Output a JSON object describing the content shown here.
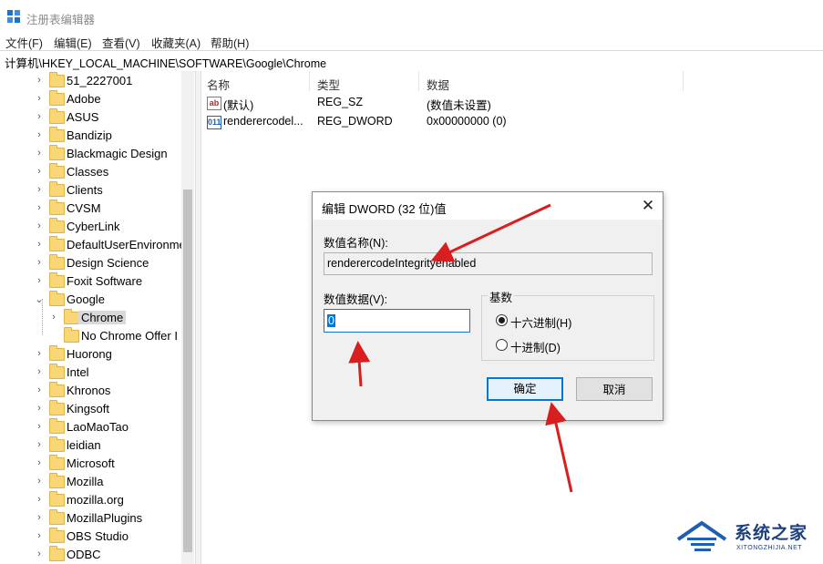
{
  "window": {
    "title": "注册表编辑器"
  },
  "menu": [
    "文件(F)",
    "编辑(E)",
    "查看(V)",
    "收藏夹(A)",
    "帮助(H)"
  ],
  "address": "计算机\\HKEY_LOCAL_MACHINE\\SOFTWARE\\Google\\Chrome",
  "tree": {
    "items": [
      {
        "label": "51_2227001",
        "chev": "›"
      },
      {
        "label": "Adobe",
        "chev": "›"
      },
      {
        "label": "ASUS",
        "chev": "›"
      },
      {
        "label": "Bandizip",
        "chev": "›"
      },
      {
        "label": "Blackmagic Design",
        "chev": "›"
      },
      {
        "label": "Classes",
        "chev": "›"
      },
      {
        "label": "Clients",
        "chev": "›"
      },
      {
        "label": "CVSM",
        "chev": "›"
      },
      {
        "label": "CyberLink",
        "chev": "›"
      },
      {
        "label": "DefaultUserEnvironme",
        "chev": "›"
      },
      {
        "label": "Design Science",
        "chev": "›"
      },
      {
        "label": "Foxit Software",
        "chev": "›"
      },
      {
        "label": "Google",
        "chev": "⌄"
      },
      {
        "label": "Chrome",
        "chev": "›"
      },
      {
        "label": "No Chrome Offer I",
        "chev": ""
      },
      {
        "label": "Huorong",
        "chev": "›"
      },
      {
        "label": "Intel",
        "chev": "›"
      },
      {
        "label": "Khronos",
        "chev": "›"
      },
      {
        "label": "Kingsoft",
        "chev": "›"
      },
      {
        "label": "LaoMaoTao",
        "chev": "›"
      },
      {
        "label": "leidian",
        "chev": "›"
      },
      {
        "label": "Microsoft",
        "chev": "›"
      },
      {
        "label": "Mozilla",
        "chev": "›"
      },
      {
        "label": "mozilla.org",
        "chev": "›"
      },
      {
        "label": "MozillaPlugins",
        "chev": "›"
      },
      {
        "label": "OBS Studio",
        "chev": "›"
      },
      {
        "label": "ODBC",
        "chev": "›"
      }
    ]
  },
  "list": {
    "headers": [
      "名称",
      "类型",
      "数据"
    ],
    "rows": [
      {
        "icon": "ab",
        "name": "(默认)",
        "type": "REG_SZ",
        "data": "(数值未设置)"
      },
      {
        "icon": "011",
        "name": "renderercodel...",
        "type": "REG_DWORD",
        "data": "0x00000000 (0)"
      }
    ]
  },
  "dialog": {
    "title": "编辑 DWORD (32 位)值",
    "close": "✕",
    "name_label": "数值名称(N):",
    "name_value": "renderercodeIntegrityenabled",
    "data_label": "数值数据(V):",
    "data_value": "0",
    "base_label": "基数",
    "radio_hex": "十六进制(H)",
    "radio_dec": "十进制(D)",
    "ok": "确定",
    "cancel": "取消"
  },
  "watermark": {
    "text": "系统之家",
    "sub": "XITONGZHIJIA.NET"
  },
  "colors": {
    "arrow": "#d81e1e",
    "selection": "#0078d7",
    "folder": "#f8d776"
  }
}
